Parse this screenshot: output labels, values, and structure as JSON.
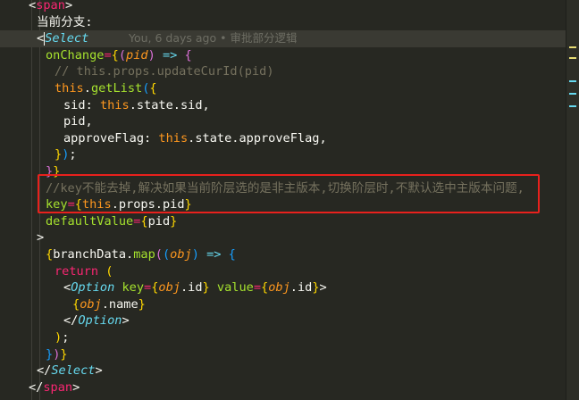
{
  "editor": {
    "lines": [
      [
        {
          "t": "<",
          "c": "plain"
        },
        {
          "t": "span",
          "c": "tag"
        },
        {
          "t": ">",
          "c": "plain"
        }
      ],
      [
        {
          "t": "当前分支:",
          "c": "plain"
        }
      ],
      [
        {
          "t": "<",
          "c": "plain"
        },
        {
          "t": "Select",
          "c": "comp"
        }
      ],
      [
        {
          "t": "onChange",
          "c": "attr"
        },
        {
          "t": "=",
          "c": "op"
        },
        {
          "t": "{",
          "c": "brace1"
        },
        {
          "t": "(",
          "c": "brace2"
        },
        {
          "t": "pid",
          "c": "param"
        },
        {
          "t": ")",
          "c": "brace2"
        },
        {
          "t": " => ",
          "c": "kw"
        },
        {
          "t": "{",
          "c": "brace2"
        }
      ],
      [
        {
          "t": "// this.props.updateCurId(pid)",
          "c": "comment"
        }
      ],
      [
        {
          "t": "this",
          "c": "thiskw"
        },
        {
          "t": ".",
          "c": "plain"
        },
        {
          "t": "getList",
          "c": "fn"
        },
        {
          "t": "(",
          "c": "brace3"
        },
        {
          "t": "{",
          "c": "brace1"
        }
      ],
      [
        {
          "t": "sid",
          "c": "plain"
        },
        {
          "t": ": ",
          "c": "plain"
        },
        {
          "t": "this",
          "c": "thiskw"
        },
        {
          "t": ".state.sid,",
          "c": "plain"
        }
      ],
      [
        {
          "t": "pid,",
          "c": "plain"
        }
      ],
      [
        {
          "t": "approveFlag",
          "c": "plain"
        },
        {
          "t": ": ",
          "c": "plain"
        },
        {
          "t": "this",
          "c": "thiskw"
        },
        {
          "t": ".state.approveFlag,",
          "c": "plain"
        }
      ],
      [
        {
          "t": "}",
          "c": "brace1"
        },
        {
          "t": ")",
          "c": "brace3"
        },
        {
          "t": ";",
          "c": "plain"
        }
      ],
      [
        {
          "t": "}",
          "c": "brace2"
        },
        {
          "t": "}",
          "c": "brace1"
        }
      ],
      [
        {
          "t": "//key不能去掉,解决如果当前阶层选的是非主版本,切换阶层时,不默认选中主版本问题,",
          "c": "comment"
        }
      ],
      [
        {
          "t": "key",
          "c": "attr"
        },
        {
          "t": "=",
          "c": "op"
        },
        {
          "t": "{",
          "c": "brace1"
        },
        {
          "t": "this",
          "c": "thiskw"
        },
        {
          "t": ".props.pid",
          "c": "plain"
        },
        {
          "t": "}",
          "c": "brace1"
        }
      ],
      [
        {
          "t": "defaultValue",
          "c": "attr"
        },
        {
          "t": "=",
          "c": "op"
        },
        {
          "t": "{",
          "c": "brace1"
        },
        {
          "t": "pid",
          "c": "plain"
        },
        {
          "t": "}",
          "c": "brace1"
        }
      ],
      [
        {
          "t": ">",
          "c": "plain"
        }
      ],
      [
        {
          "t": "{",
          "c": "brace1"
        },
        {
          "t": "branchData.",
          "c": "plain"
        },
        {
          "t": "map",
          "c": "fn"
        },
        {
          "t": "(",
          "c": "brace2"
        },
        {
          "t": "(",
          "c": "brace3"
        },
        {
          "t": "obj",
          "c": "param"
        },
        {
          "t": ")",
          "c": "brace3"
        },
        {
          "t": " => ",
          "c": "kw"
        },
        {
          "t": "{",
          "c": "brace3"
        }
      ],
      [
        {
          "t": "return",
          "c": "tag"
        },
        {
          "t": " (",
          "c": "brace1"
        }
      ],
      [
        {
          "t": "<",
          "c": "plain"
        },
        {
          "t": "Option",
          "c": "comp"
        },
        {
          "t": " ",
          "c": "plain"
        },
        {
          "t": "key",
          "c": "attr"
        },
        {
          "t": "=",
          "c": "op"
        },
        {
          "t": "{",
          "c": "brace1"
        },
        {
          "t": "obj",
          "c": "param"
        },
        {
          "t": ".id",
          "c": "plain"
        },
        {
          "t": "}",
          "c": "brace1"
        },
        {
          "t": " ",
          "c": "plain"
        },
        {
          "t": "value",
          "c": "attr"
        },
        {
          "t": "=",
          "c": "op"
        },
        {
          "t": "{",
          "c": "brace1"
        },
        {
          "t": "obj",
          "c": "param"
        },
        {
          "t": ".id",
          "c": "plain"
        },
        {
          "t": "}",
          "c": "brace1"
        },
        {
          "t": ">",
          "c": "plain"
        }
      ],
      [
        {
          "t": "{",
          "c": "brace1"
        },
        {
          "t": "obj",
          "c": "param"
        },
        {
          "t": ".name",
          "c": "plain"
        },
        {
          "t": "}",
          "c": "brace1"
        }
      ],
      [
        {
          "t": "</",
          "c": "plain"
        },
        {
          "t": "Option",
          "c": "comp"
        },
        {
          "t": ">",
          "c": "plain"
        }
      ],
      [
        {
          "t": ")",
          "c": "brace1"
        },
        {
          "t": ";",
          "c": "plain"
        }
      ],
      [
        {
          "t": "}",
          "c": "brace3"
        },
        {
          "t": ")",
          "c": "brace2"
        },
        {
          "t": "}",
          "c": "brace1"
        }
      ],
      [
        {
          "t": "</",
          "c": "plain"
        },
        {
          "t": "Select",
          "c": "comp"
        },
        {
          "t": ">",
          "c": "plain"
        }
      ],
      [
        {
          "t": "</",
          "c": "plain"
        },
        {
          "t": "span",
          "c": "tag"
        },
        {
          "t": ">",
          "c": "plain"
        }
      ]
    ],
    "blame": "You, 6 days ago • 审批部分逻辑"
  },
  "colors": {
    "background": "#272822",
    "highlight_border": "#e8211d"
  }
}
